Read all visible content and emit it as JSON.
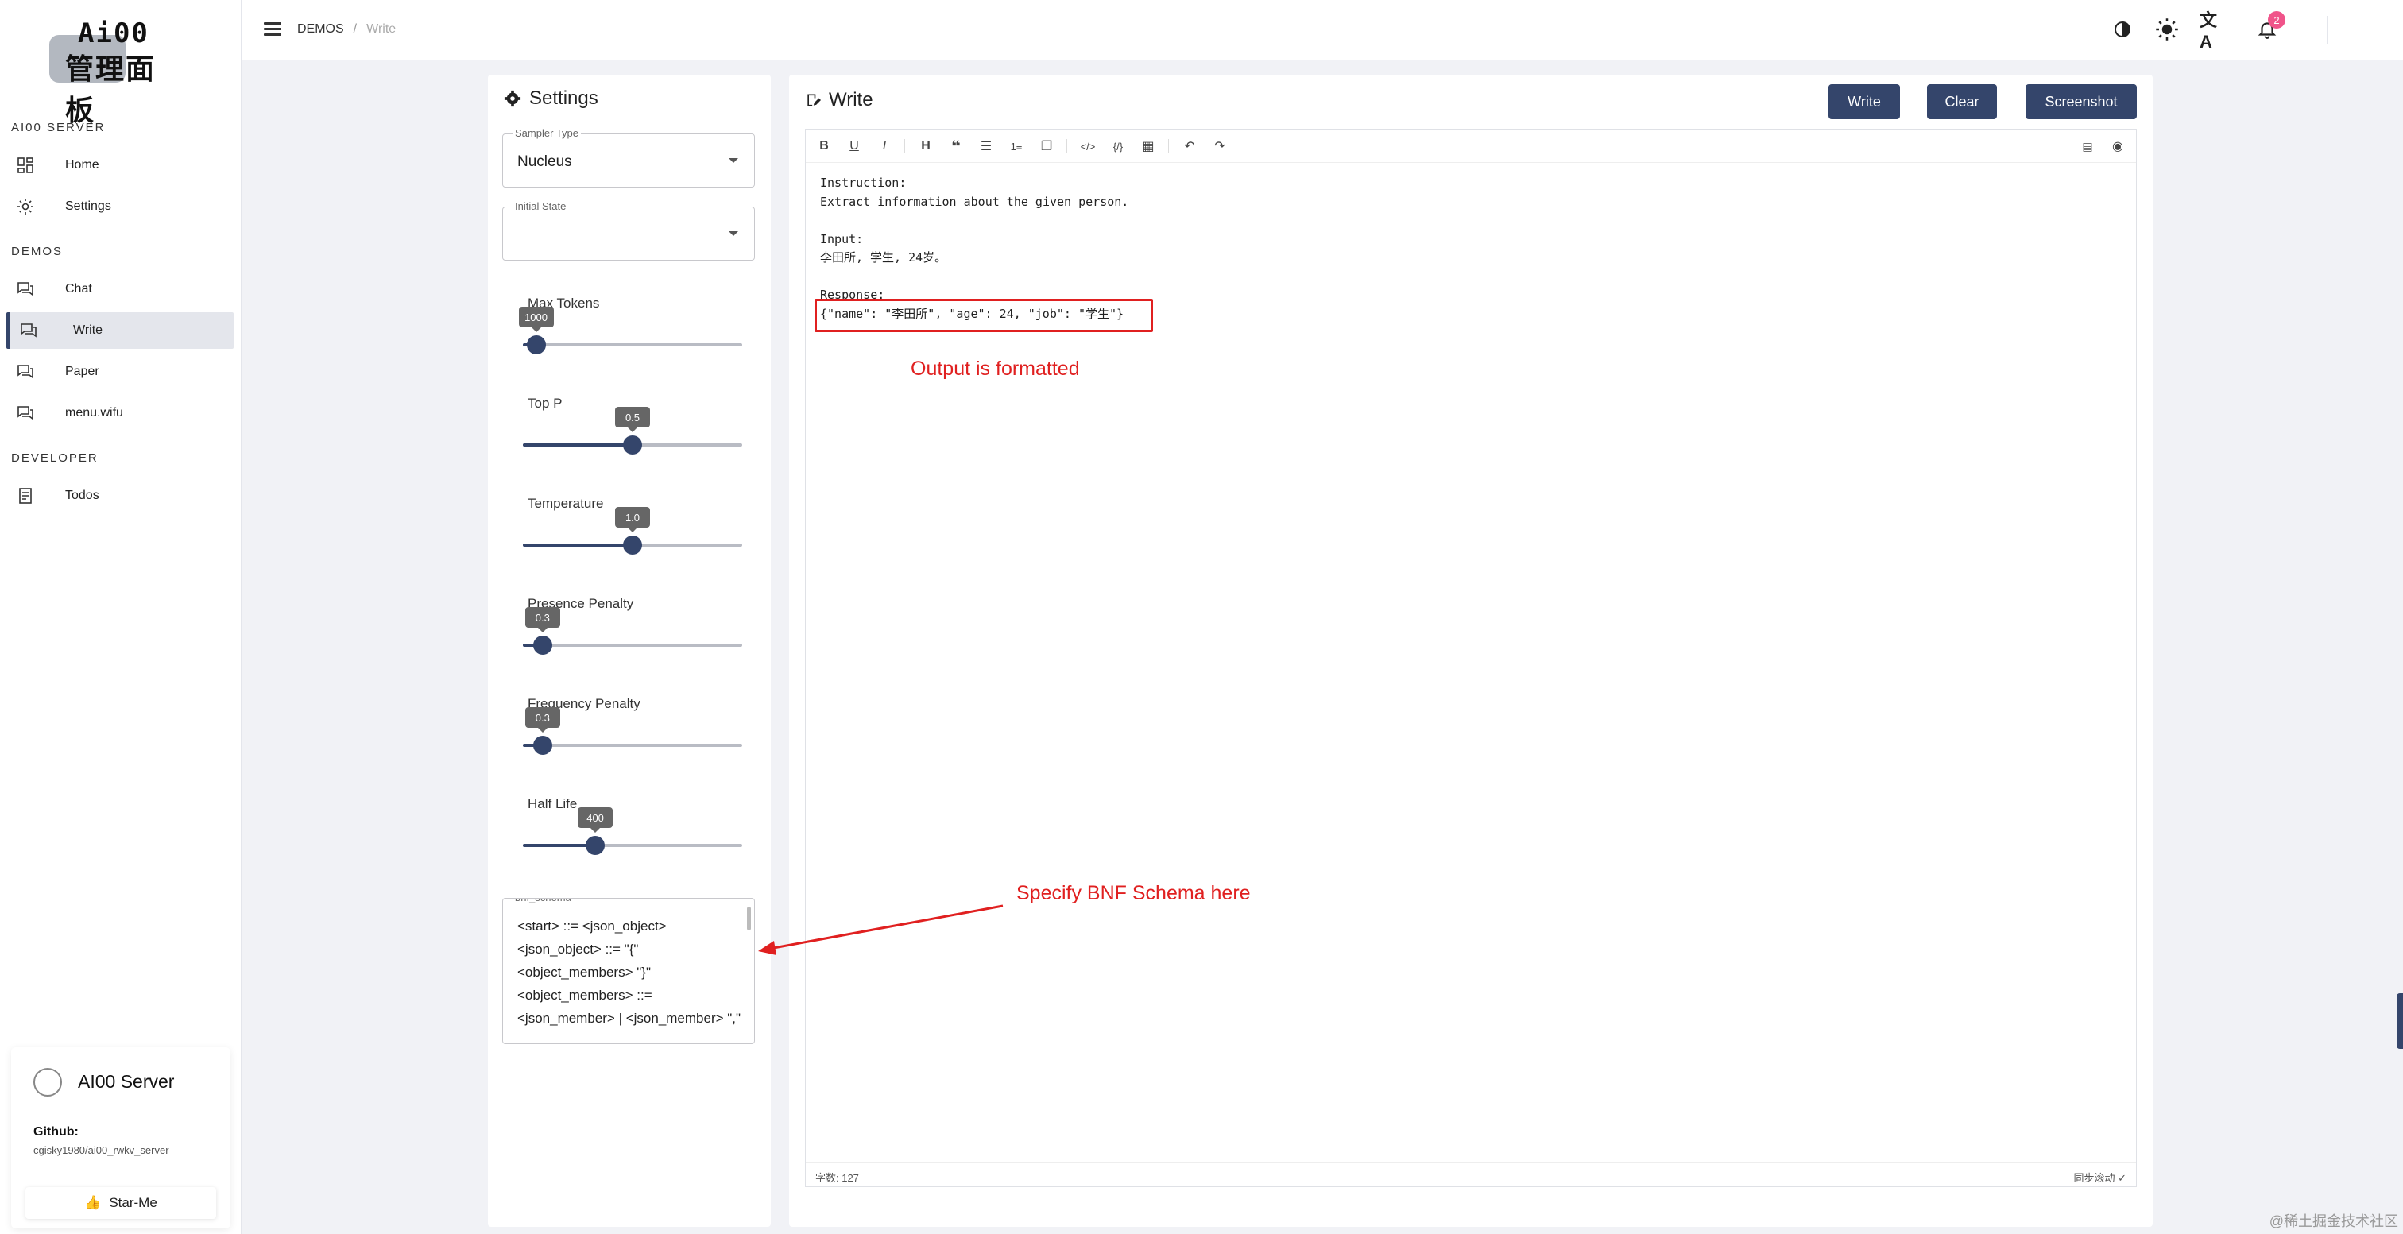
{
  "logo": {
    "top": "Ai00",
    "bottom": "管理面板"
  },
  "sidebar": {
    "sections": [
      {
        "title": "AI00 SERVER",
        "items": [
          {
            "label": "Home",
            "icon": "dashboard-icon"
          },
          {
            "label": "Settings",
            "icon": "gear-icon"
          }
        ]
      },
      {
        "title": "DEMOS",
        "items": [
          {
            "label": "Chat",
            "icon": "chat-icon"
          },
          {
            "label": "Write",
            "icon": "chat-icon",
            "active": true
          },
          {
            "label": "Paper",
            "icon": "chat-icon"
          },
          {
            "label": "menu.wifu",
            "icon": "chat-icon"
          }
        ]
      },
      {
        "title": "DEVELOPER",
        "items": [
          {
            "label": "Todos",
            "icon": "document-icon"
          }
        ]
      }
    ],
    "server_card": {
      "title": "AI00 Server",
      "github_label": "Github:",
      "github_link": "cgisky1980/ai00_rwkv_server",
      "star_label": "Star-Me"
    }
  },
  "header": {
    "breadcrumb": [
      "DEMOS",
      "Write"
    ],
    "separator": "/",
    "notification_count": "2"
  },
  "settings": {
    "title": "Settings",
    "sampler": {
      "legend": "Sampler Type",
      "value": "Nucleus"
    },
    "initial_state": {
      "legend": "Initial State",
      "value": ""
    },
    "sliders": [
      {
        "label": "Max Tokens",
        "value": "1000",
        "fraction": 0.06
      },
      {
        "label": "Top P",
        "value": "0.5",
        "fraction": 0.5
      },
      {
        "label": "Temperature",
        "value": "1.0",
        "fraction": 0.5
      },
      {
        "label": "Presence Penalty",
        "value": "0.3",
        "fraction": 0.09
      },
      {
        "label": "Frequency Penalty",
        "value": "0.3",
        "fraction": 0.09
      },
      {
        "label": "Half Life",
        "value": "400",
        "fraction": 0.33
      }
    ],
    "bnf": {
      "legend": "bnf_schema",
      "text": "<start> ::= <json_object>\n<json_object> ::= \"{\" <object_members> \"}\"\n<object_members> ::= <json_member> | <json_member> \",\" ..."
    }
  },
  "write": {
    "title": "Write",
    "buttons": {
      "write": "Write",
      "clear": "Clear",
      "screenshot": "Screenshot"
    },
    "content": "Instruction:\nExtract information about the given person.\n\nInput:\n李田所, 学生, 24岁。\n\nResponse:\n{\"name\": \"李田所\", \"age\": 24, \"job\": \"学生\"}",
    "annotation_output": "Output is formatted",
    "annotation_schema": "Specify BNF Schema here",
    "status_left": "字数: 127",
    "status_right": "同步滚动 ✓"
  },
  "watermark": "@稀土掘金技术社区"
}
